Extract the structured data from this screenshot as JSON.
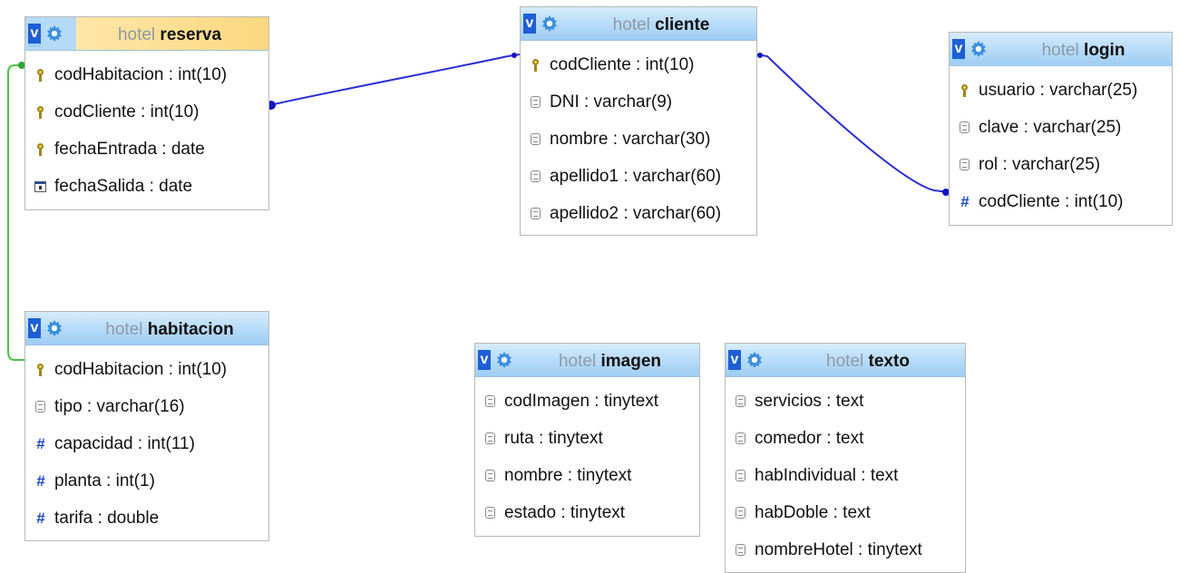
{
  "schema": "hotel",
  "tables": {
    "reserva": {
      "name": "reserva",
      "columns": [
        {
          "label": "codHabitacion : int(10)",
          "icon": "key-icon"
        },
        {
          "label": "codCliente : int(10)",
          "icon": "key-icon"
        },
        {
          "label": "fechaEntrada : date",
          "icon": "key-icon"
        },
        {
          "label": "fechaSalida : date",
          "icon": "date-icon"
        }
      ]
    },
    "cliente": {
      "name": "cliente",
      "columns": [
        {
          "label": "codCliente : int(10)",
          "icon": "key-icon"
        },
        {
          "label": "DNI : varchar(9)",
          "icon": "text-field-icon"
        },
        {
          "label": "nombre : varchar(30)",
          "icon": "text-field-icon"
        },
        {
          "label": "apellido1 : varchar(60)",
          "icon": "text-field-icon"
        },
        {
          "label": "apellido2 : varchar(60)",
          "icon": "text-field-icon"
        }
      ]
    },
    "login": {
      "name": "login",
      "columns": [
        {
          "label": "usuario : varchar(25)",
          "icon": "key-icon"
        },
        {
          "label": "clave : varchar(25)",
          "icon": "text-field-icon"
        },
        {
          "label": "rol : varchar(25)",
          "icon": "text-field-icon"
        },
        {
          "label": "codCliente : int(10)",
          "icon": "number-icon"
        }
      ]
    },
    "habitacion": {
      "name": "habitacion",
      "columns": [
        {
          "label": "codHabitacion : int(10)",
          "icon": "key-icon"
        },
        {
          "label": "tipo : varchar(16)",
          "icon": "text-field-icon"
        },
        {
          "label": "capacidad : int(11)",
          "icon": "number-icon"
        },
        {
          "label": "planta : int(1)",
          "icon": "number-icon"
        },
        {
          "label": "tarifa : double",
          "icon": "number-icon"
        }
      ]
    },
    "imagen": {
      "name": "imagen",
      "columns": [
        {
          "label": "codImagen : tinytext",
          "icon": "text-field-icon"
        },
        {
          "label": "ruta : tinytext",
          "icon": "text-field-icon"
        },
        {
          "label": "nombre : tinytext",
          "icon": "text-field-icon"
        },
        {
          "label": "estado : tinytext",
          "icon": "text-field-icon"
        }
      ]
    },
    "texto": {
      "name": "texto",
      "columns": [
        {
          "label": "servicios : text",
          "icon": "text-field-icon"
        },
        {
          "label": "comedor : text",
          "icon": "text-field-icon"
        },
        {
          "label": "habIndividual : text",
          "icon": "text-field-icon"
        },
        {
          "label": "habDoble : text",
          "icon": "text-field-icon"
        },
        {
          "label": "nombreHotel : tinytext",
          "icon": "text-field-icon"
        }
      ]
    }
  },
  "header_toggle_label": "v",
  "colors": {
    "relation_blue": "#2b2bd6",
    "relation_green": "#4cc24c",
    "header_blue": "#b5daf7",
    "header_selected": "#fbd880",
    "schema_gray": "#8f9aa5",
    "number_icon_blue": "#1a47c8"
  }
}
